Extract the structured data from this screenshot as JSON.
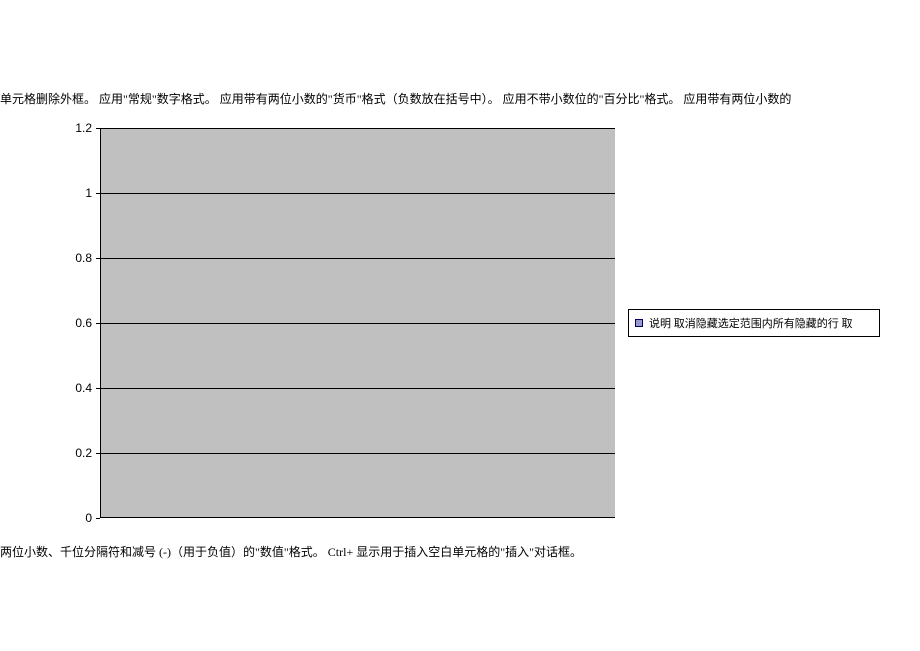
{
  "top_text": "单元格删除外框。 应用\"常规\"数字格式。 应用带有两位小数的\"货币\"格式（负数放在括号中）。 应用不带小数位的\"百分比\"格式。 应用带有两位小数的",
  "bottom_text": "两位小数、千位分隔符和减号 (-)（用于负值）的\"数值\"格式。    Ctrl+ 显示用于插入空白单元格的\"插入\"对话框。",
  "chart_data": {
    "type": "bar",
    "categories": [],
    "series": [
      {
        "name": "说明 取消隐藏选定范围内所有隐藏的行 取",
        "values": []
      }
    ],
    "title": "",
    "xlabel": "",
    "ylabel": "",
    "ylim": [
      0,
      1.2
    ],
    "yticks": [
      0,
      0.2,
      0.4,
      0.6,
      0.8,
      1,
      1.2
    ],
    "grid": true,
    "legend_position": "right"
  },
  "yticks_display": {
    "0": "0",
    "1": "0.2",
    "2": "0.4",
    "3": "0.6",
    "4": "0.8",
    "5": "1",
    "6": "1.2"
  }
}
